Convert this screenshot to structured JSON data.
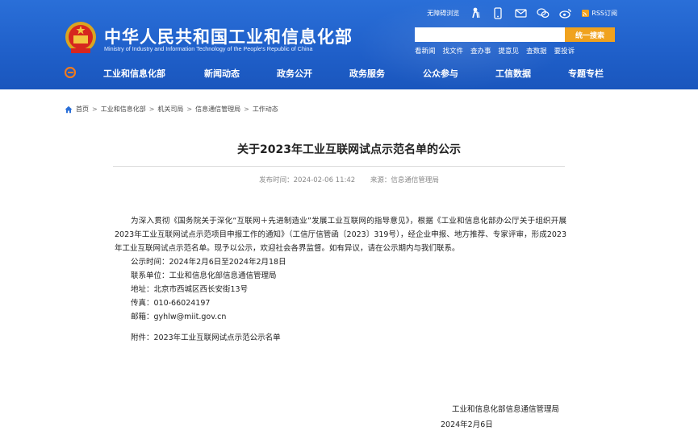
{
  "header": {
    "title": "中华人民共和国工业和信息化部",
    "subtitle": "Ministry of Industry and Information Technology of the People's Republic of China",
    "util": {
      "accessibility": "无障碍浏览",
      "rss": "RSS订阅"
    },
    "search": {
      "placeholder": "",
      "button": "统一搜索"
    },
    "quick_links": [
      "看新闻",
      "找文件",
      "查办事",
      "提意见",
      "查数据",
      "要投诉"
    ],
    "colors": {
      "bar": "#1f5fc9",
      "accent": "#f0a21e"
    }
  },
  "nav": {
    "items": [
      "工业和信息化部",
      "新闻动态",
      "政务公开",
      "政务服务",
      "公众参与",
      "工信数据",
      "专题专栏"
    ]
  },
  "breadcrumb": [
    "首页",
    "工业和信息化部",
    "机关司局",
    "信息通信管理局",
    "工作动态"
  ],
  "article": {
    "title": "关于2023年工业互联网试点示范名单的公示",
    "publish_time": "发布时间：2024-02-06 11:42",
    "source": "来源：信息通信管理局",
    "paragraph": "为深入贯彻《国务院关于深化“互联网＋先进制造业”发展工业互联网的指导意见》，根据《工业和信息化部办公厅关于组织开展2023年工业互联网试点示范项目申报工作的通知》（工信厅信管函〔2023〕319号），经企业申报、地方推荐、专家评审，形成2023年工业互联网试点示范名单。现予以公示，欢迎社会各界监督。如有异议，请在公示期内与我们联系。",
    "lines": [
      "公示时间：2024年2月6日至2024年2月18日",
      "联系单位：工业和信息化部信息通信管理局",
      "地址：北京市西城区西长安街13号",
      "传真：010-66024197",
      "邮箱：gyhlw@miit.gov.cn"
    ],
    "attachment": "附件：2023年工业互联网试点示范公示名单",
    "signature": "工业和信息化部信息通信管理局",
    "date": "2024年2月6日"
  }
}
